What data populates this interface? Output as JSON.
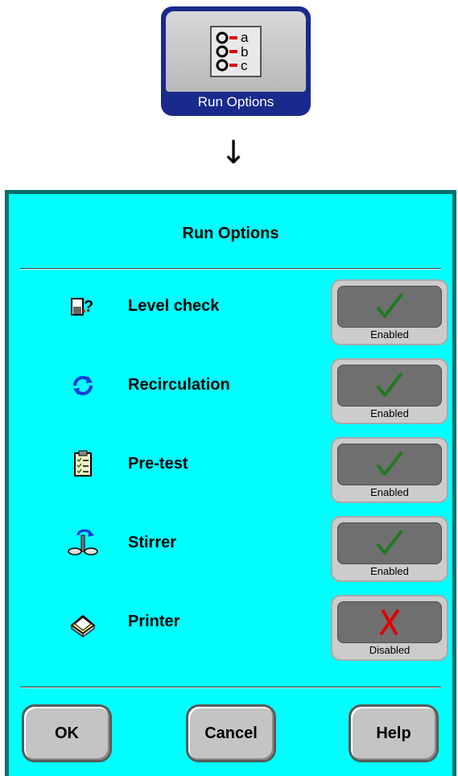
{
  "launcher": {
    "label": "Run Options",
    "icon": "abc-options-icon",
    "icon_letters": [
      "a",
      "b",
      "c"
    ]
  },
  "arrow": "↓",
  "dialog": {
    "title": "Run Options",
    "options": [
      {
        "id": "level-check",
        "label": "Level check",
        "icon": "level-check-icon",
        "enabled": true,
        "state_label": "Enabled"
      },
      {
        "id": "recirculation",
        "label": "Recirculation",
        "icon": "recirculation-icon",
        "enabled": true,
        "state_label": "Enabled"
      },
      {
        "id": "pre-test",
        "label": "Pre-test",
        "icon": "clipboard-icon",
        "enabled": true,
        "state_label": "Enabled"
      },
      {
        "id": "stirrer",
        "label": "Stirrer",
        "icon": "stirrer-icon",
        "enabled": true,
        "state_label": "Enabled"
      },
      {
        "id": "printer",
        "label": "Printer",
        "icon": "printer-icon",
        "enabled": false,
        "state_label": "Disabled"
      }
    ],
    "buttons": {
      "ok": "OK",
      "cancel": "Cancel",
      "help": "Help"
    }
  },
  "colors": {
    "dialog_bg": "#00ffff",
    "dialog_border": "#0b6e6b",
    "launcher_bg": "#1a2a8c",
    "enabled_check": "#1f7a1f",
    "disabled_x": "#e00000"
  }
}
